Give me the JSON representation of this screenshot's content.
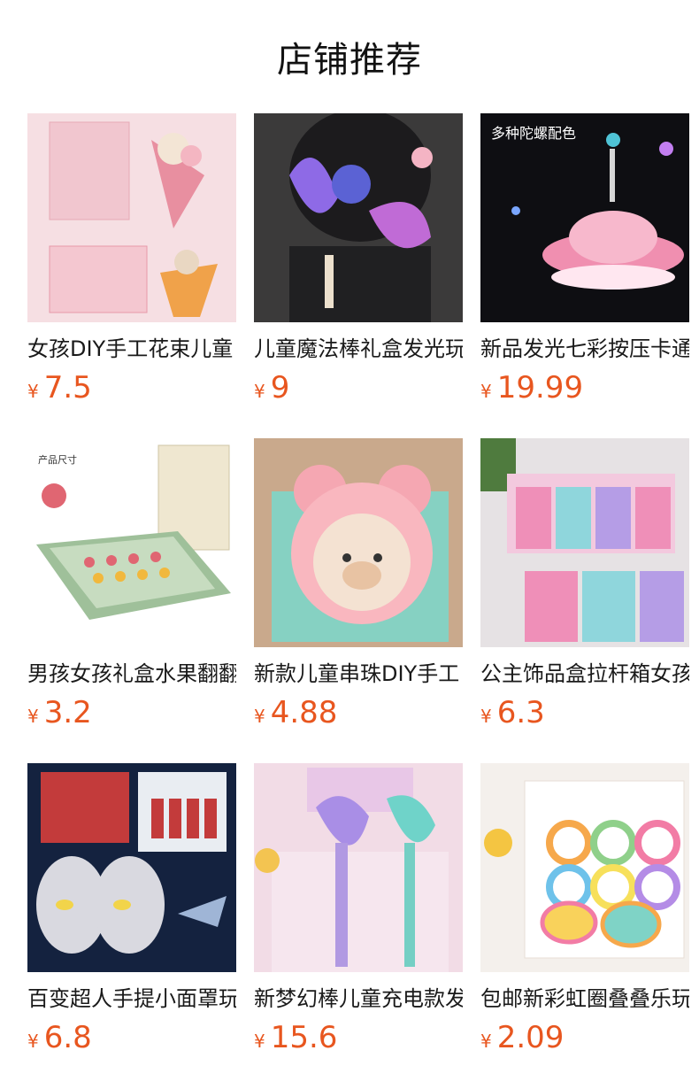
{
  "header": {
    "title": "店铺推荐"
  },
  "currency_symbol": "¥",
  "products": [
    {
      "title": "女孩DIY手工花束儿童",
      "price": "7.5",
      "image": {
        "name": "flower-bouquet-kit-image",
        "bg": "#f6dfe3",
        "accent": "#e88fa0"
      }
    },
    {
      "title": "儿童魔法棒礼盒发光玩",
      "price": "9",
      "image": {
        "name": "magic-wand-photo",
        "bg": "#3b3a3a",
        "accent": "#8e6ae6"
      }
    },
    {
      "title": "新品发光七彩按压卡通",
      "price": "19.99",
      "image": {
        "name": "ufo-spinner-toy-image",
        "bg": "#0e0e12",
        "accent": "#f08fb0",
        "overlay_text": "多种陀螺配色"
      }
    },
    {
      "title": "男孩女孩礼盒水果翻翻",
      "price": "3.2",
      "image": {
        "name": "fruit-flip-board-game-image",
        "bg": "#ffffff",
        "accent": "#9fc09a",
        "overlay_text": "产品尺寸"
      }
    },
    {
      "title": "新款儿童串珠DIY手工",
      "price": "4.88",
      "image": {
        "name": "bear-bead-kit-image",
        "bg": "#c9a98c",
        "accent": "#f5a7b2"
      }
    },
    {
      "title": "公主饰品盒拉杆箱女孩",
      "price": "6.3",
      "image": {
        "name": "princess-jewelry-box-image",
        "bg": "#e6e2e4",
        "accent": "#ef8fb8"
      }
    },
    {
      "title": "百变超人手提小面罩玩",
      "price": "6.8",
      "image": {
        "name": "superhero-mask-image",
        "bg": "#14223f",
        "accent": "#d9d9e0"
      }
    },
    {
      "title": "新梦幻棒儿童充电款发",
      "price": "15.6",
      "image": {
        "name": "dream-wand-charging-image",
        "bg": "#f2dce6",
        "accent": "#a98ee6"
      }
    },
    {
      "title": "包邮新彩虹圈叠叠乐玩",
      "price": "2.09",
      "image": {
        "name": "rainbow-spring-image",
        "bg": "#f4f0ec",
        "accent": "#f4c542"
      }
    }
  ]
}
